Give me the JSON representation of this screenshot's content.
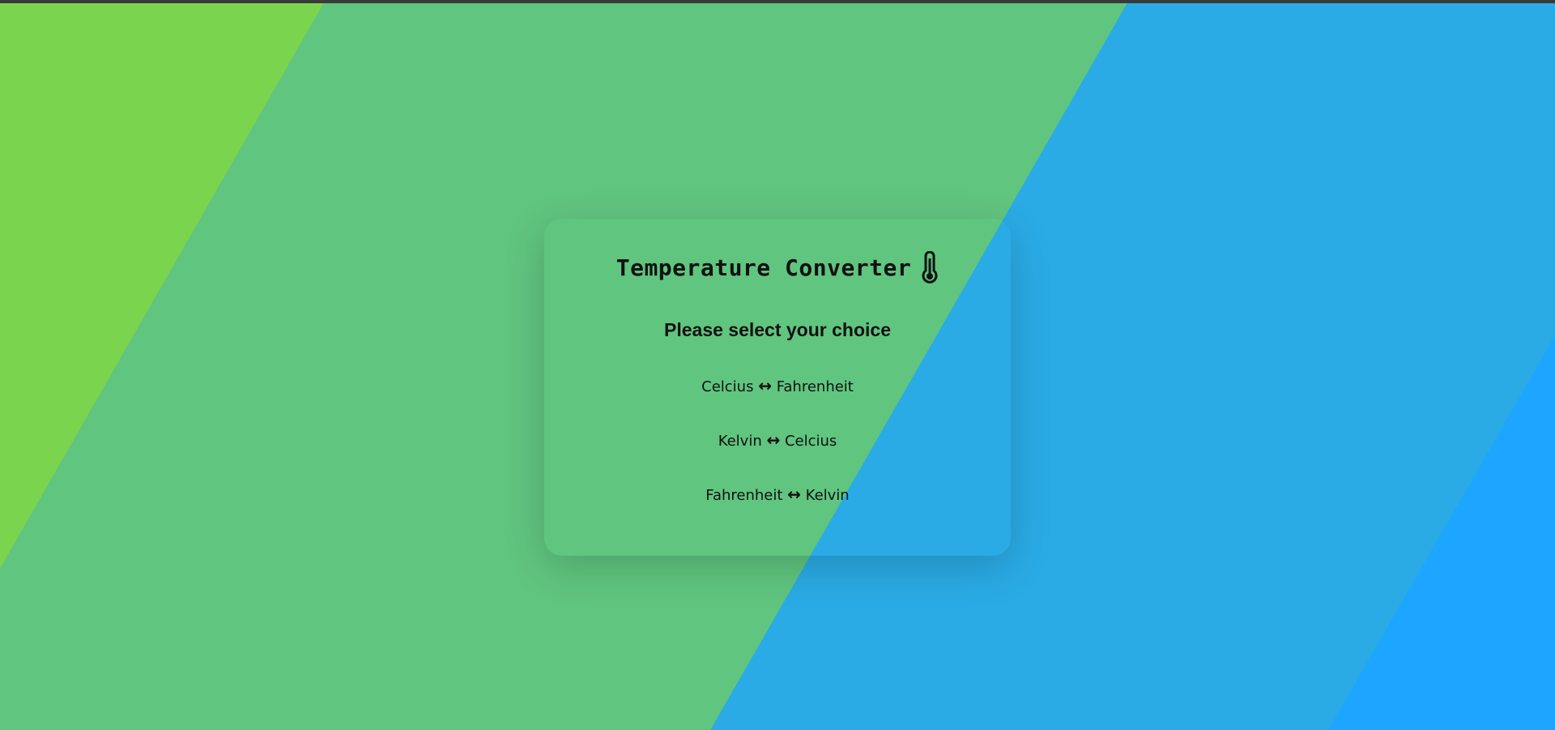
{
  "app": {
    "title": "Temperature Converter",
    "title_icon": "thermometer-icon"
  },
  "prompt": "Please select your choice",
  "choices": [
    {
      "from": "Celcius",
      "arrow": "↔",
      "to": "Fahrenheit"
    },
    {
      "from": "Kelvin",
      "arrow": "↔",
      "to": "Celcius"
    },
    {
      "from": "Fahrenheit",
      "arrow": "↔",
      "to": "Kelvin"
    }
  ],
  "colors": {
    "background_green_light": "#7bd44e",
    "background_green": "#60c57f",
    "background_blue": "#2aabe5",
    "background_blue_bright": "#1ea5ff",
    "text": "#111111"
  }
}
